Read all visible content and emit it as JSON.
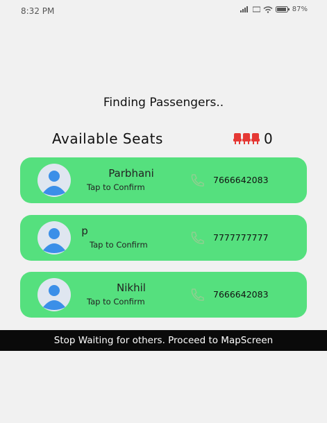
{
  "status_bar": {
    "time": "8:32 PM",
    "battery": "87%"
  },
  "header": {
    "title": "Finding Passengers.."
  },
  "seats": {
    "label": "Available Seats",
    "count": "0"
  },
  "passengers": [
    {
      "name": "Parbhani",
      "action": "Tap to Confirm",
      "phone": "7666642083"
    },
    {
      "name": "p",
      "action": "Tap to Confirm",
      "phone": "7777777777"
    },
    {
      "name": "Nikhil",
      "action": "Tap to Confirm",
      "phone": "7666642083"
    }
  ],
  "footer": {
    "proceed_label": "Stop Waiting for others. Proceed to MapScreen"
  },
  "colors": {
    "card_bg": "#55e07e",
    "avatar_circle": "#dfe6f0",
    "avatar_figure": "#3b8fe8",
    "seat_icon": "#e53935",
    "phone_icon": "#8fcf90",
    "bar_bg": "#0a0a0a"
  },
  "icons": {
    "seat": "seat-icon",
    "avatar": "avatar-icon",
    "phone": "phone-icon"
  }
}
